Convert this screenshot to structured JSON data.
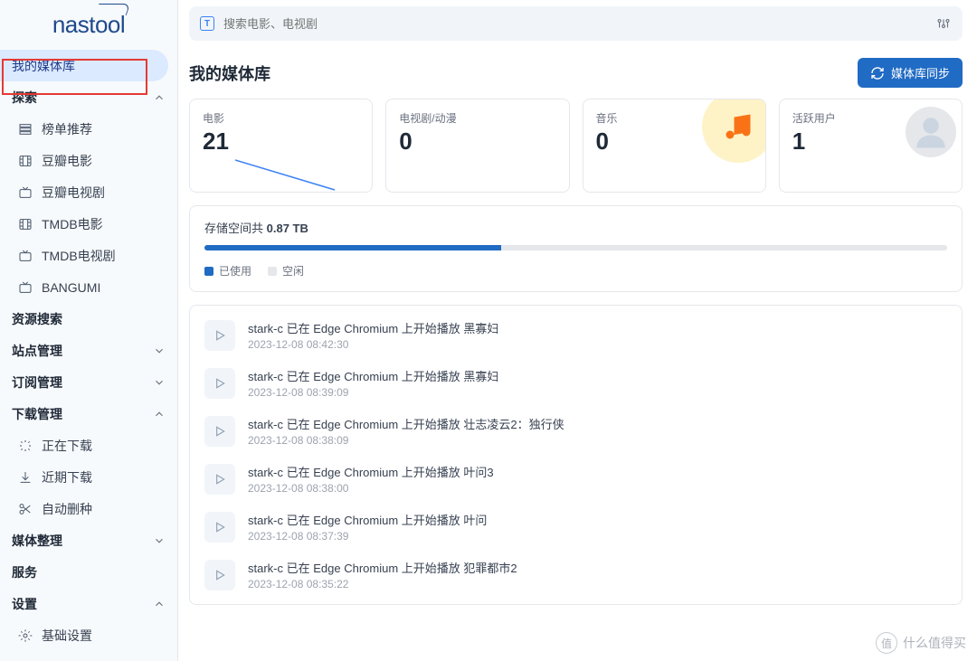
{
  "logo": "nastool",
  "search": {
    "placeholder": "搜索电影、电视剧"
  },
  "sidebar": {
    "active": "我的媒体库",
    "groups": [
      {
        "label": "探索",
        "expanded": true,
        "items": [
          {
            "icon": "list",
            "label": "榜单推荐"
          },
          {
            "icon": "film",
            "label": "豆瓣电影"
          },
          {
            "icon": "tv",
            "label": "豆瓣电视剧"
          },
          {
            "icon": "film",
            "label": "TMDB电影"
          },
          {
            "icon": "tv",
            "label": "TMDB电视剧"
          },
          {
            "icon": "tv",
            "label": "BANGUMI"
          }
        ]
      },
      {
        "label": "资源搜索",
        "expanded": null
      },
      {
        "label": "站点管理",
        "expanded": false
      },
      {
        "label": "订阅管理",
        "expanded": false
      },
      {
        "label": "下载管理",
        "expanded": true,
        "items": [
          {
            "icon": "loading",
            "label": "正在下载"
          },
          {
            "icon": "download",
            "label": "近期下载"
          },
          {
            "icon": "scissors",
            "label": "自动删种"
          }
        ]
      },
      {
        "label": "媒体整理",
        "expanded": false
      },
      {
        "label": "服务",
        "expanded": null
      },
      {
        "label": "设置",
        "expanded": true,
        "items": [
          {
            "icon": "gear",
            "label": "基础设置"
          }
        ]
      }
    ]
  },
  "page": {
    "title": "我的媒体库",
    "sync_label": "媒体库同步"
  },
  "stats": [
    {
      "label": "电影",
      "value": "21",
      "kind": "movie"
    },
    {
      "label": "电视剧/动漫",
      "value": "0",
      "kind": "tv"
    },
    {
      "label": "音乐",
      "value": "0",
      "kind": "music"
    },
    {
      "label": "活跃用户",
      "value": "1",
      "kind": "user"
    }
  ],
  "storage": {
    "prefix": "存储空间共 ",
    "total": "0.87 TB",
    "used_pct": 40,
    "legend_used": "已使用",
    "legend_free": "空闲"
  },
  "activity": [
    {
      "text": "stark-c 已在 Edge Chromium 上开始播放 黑寡妇",
      "time": "2023-12-08 08:42:30"
    },
    {
      "text": "stark-c 已在 Edge Chromium 上开始播放 黑寡妇",
      "time": "2023-12-08 08:39:09"
    },
    {
      "text": "stark-c 已在 Edge Chromium 上开始播放 壮志凌云2：独行侠",
      "time": "2023-12-08 08:38:09"
    },
    {
      "text": "stark-c 已在 Edge Chromium 上开始播放 叶问3",
      "time": "2023-12-08 08:38:00"
    },
    {
      "text": "stark-c 已在 Edge Chromium 上开始播放 叶问",
      "time": "2023-12-08 08:37:39"
    },
    {
      "text": "stark-c 已在 Edge Chromium 上开始播放 犯罪都市2",
      "time": "2023-12-08 08:35:22"
    }
  ],
  "watermark": "什么值得买"
}
